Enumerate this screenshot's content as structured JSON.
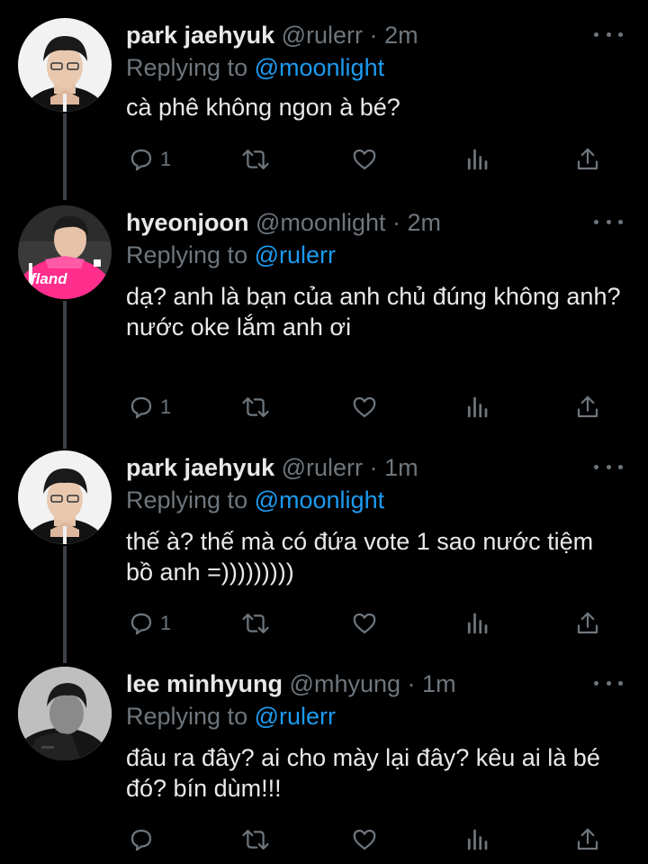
{
  "colors": {
    "background": "#000000",
    "text_primary": "#e7e9ea",
    "text_secondary": "#6e767d",
    "mention": "#1d9bf0",
    "thread_line": "#3d4148"
  },
  "tweets": [
    {
      "display_name": "park jaehyuk",
      "handle": "@rulerr",
      "separator": "·",
      "time": "2m",
      "replying_label": "Replying to",
      "replying_to": "@moonlight",
      "text": "cà phê không ngon à bé?",
      "reply_count": "1",
      "avatar": "avatar-photo"
    },
    {
      "display_name": "hyeonjoon",
      "handle": "@moonlight",
      "separator": "·",
      "time": "2m",
      "replying_label": "Replying to",
      "replying_to": "@rulerr",
      "text": "dạ? anh là bạn của anh chủ đúng không anh?\nnước oke lắm anh ơi",
      "reply_count": "1",
      "avatar": "avatar-photo",
      "avatar_jersey_text": "Ifland"
    },
    {
      "display_name": "park jaehyuk",
      "handle": "@rulerr",
      "separator": "·",
      "time": "1m",
      "replying_label": "Replying to",
      "replying_to": "@moonlight",
      "text": "thế à? thế mà có đứa vote 1 sao nước tiệm bồ anh =)))))))))",
      "reply_count": "1",
      "avatar": "avatar-photo"
    },
    {
      "display_name": "lee minhyung",
      "handle": "@mhyung",
      "separator": "·",
      "time": "1m",
      "replying_label": "Replying to",
      "replying_to": "@rulerr",
      "text": "đâu ra đây? ai cho mày lại đây? kêu ai là bé đó? bín dùm!!!",
      "reply_count": "",
      "avatar": "avatar-photo"
    }
  ],
  "icons": {
    "reply": "reply-icon",
    "retweet": "retweet-icon",
    "like": "heart-icon",
    "analytics": "analytics-icon",
    "share": "share-icon",
    "more": "more-options-icon"
  }
}
